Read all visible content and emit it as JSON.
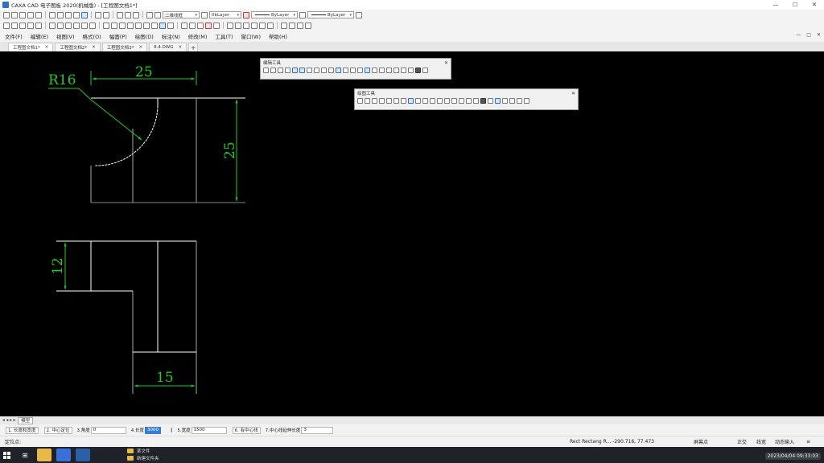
{
  "window": {
    "title": "CAXA CAD 电子图板 2020(机械版) - [工程图文档1*]",
    "minimize": "—",
    "maximize": "☐",
    "close": "✕"
  },
  "toolbar": {
    "layer_combo": "0bLayer",
    "color_combo": "ByLayer",
    "linetype_combo": "ByLayer",
    "lineweight_combo": "ByLayer",
    "ucs_combo": "二维线框"
  },
  "menu": {
    "items": [
      "文件(F)",
      "编辑(E)",
      "视图(V)",
      "格式(O)",
      "幅面(P)",
      "绘图(D)",
      "标注(N)",
      "修改(M)",
      "工具(T)",
      "窗口(W)",
      "帮助(H)"
    ],
    "ctrls": [
      "—",
      "□",
      "✕"
    ]
  },
  "tabs": [
    {
      "label": "工程图文档1*",
      "close": "✕"
    },
    {
      "label": "工程图文档2*",
      "close": "✕"
    },
    {
      "label": "工程图文档3*",
      "close": "✕"
    },
    {
      "label": "8.4.DWG",
      "close": "✕"
    }
  ],
  "tab_add": "+",
  "floating_toolbars": {
    "edit": {
      "title": "编辑工具",
      "close": "✕"
    },
    "draw": {
      "title": "绘图工具",
      "close": "✕"
    }
  },
  "drawing": {
    "radius_label": "R16",
    "dim_top": "25",
    "dim_right": "25",
    "dim_left": "12",
    "dim_bottom": "15",
    "line_color": "#ffffff",
    "dim_color": "#22cc22"
  },
  "layout_tabs": {
    "nav": "◂ ◂ ▸ ▸",
    "model": "模型"
  },
  "command": {
    "f1": "1. 长度和宽度",
    "f2": "2. 中心定位",
    "f3_label": "3.角度",
    "f3_val": "0",
    "f4_label": "4.长度",
    "f4_val": "3000",
    "f5_label": "5.宽度",
    "f5_val": "1500",
    "f6": "6. 有中心线",
    "f7_label": "7.中心线延伸长度",
    "f7_val": "3"
  },
  "status": {
    "prompt": "定位点:",
    "coords": "Rect Rectang R...   -290.716, 77.473",
    "snap": "屏幕点",
    "ortho": "正交",
    "linewidth": "线宽",
    "dynamic": "动态输入"
  },
  "taskbar": {
    "file1": "某文件",
    "file2": "新建文件夹",
    "clock": "2023/04/04 09:33:03"
  }
}
